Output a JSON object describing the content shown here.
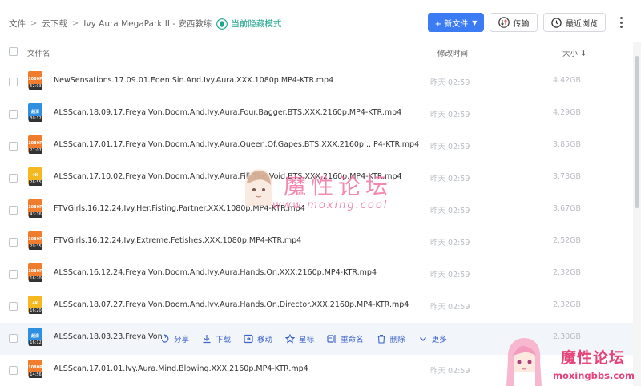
{
  "breadcrumb": {
    "items": [
      "文件",
      "云下载",
      "Ivy Aura MegaPark II - 安西教练"
    ],
    "separator": ">",
    "mode_label": "当前隐藏模式"
  },
  "toolbar": {
    "new_label": "+ 新文件",
    "transfer_label": "传输",
    "recent_label": "最近浏览"
  },
  "table": {
    "headers": {
      "name": "文件名",
      "time": "修改时间",
      "size": "大小 ⬇"
    }
  },
  "files": [
    {
      "name": "NewSensations.17.09.01.Eden.Sin.And.Ivy.Aura.XXX.1080p.MP4-KTR.mp4",
      "time": "昨天 02:59",
      "size": "4.42GB",
      "badge": "1080P",
      "duration": "52:03",
      "color": "#f07c2e"
    },
    {
      "name": "ALSScan.18.09.17.Freya.Von.Doom.And.Ivy.Aura.Four.Bagger.BTS.XXX.2160p.MP4-KTR.mp4",
      "time": "昨天 02:59",
      "size": "4.29GB",
      "badge": "超清",
      "duration": "30:12",
      "color": "#2f8fe0"
    },
    {
      "name": "ALSScan.17.01.17.Freya.Von.Doom.And.Ivy.Aura.Queen.Of.Gapes.BTS.XXX.2160p... P4-KTR.mp4",
      "time": "昨天 02:59",
      "size": "3.85GB",
      "badge": "1080P",
      "duration": "27:07",
      "color": "#f07c2e"
    },
    {
      "name": "ALSScan.17.10.02.Freya.Von.Doom.And.Ivy.Aura.Fill.The.Void.BTS.XXX.2160p.MP4-KTR.mp4",
      "time": "昨天 02:59",
      "size": "3.73GB",
      "badge": "4K",
      "duration": "26:55",
      "color": "#f5b820"
    },
    {
      "name": "FTVGirls.16.12.24.Ivy.Her.Fisting.Partner.XXX.1080p.MP4-KTR.mp4",
      "time": "昨天 02:59",
      "size": "3.67GB",
      "badge": "1080P",
      "duration": "43:16",
      "color": "#f07c2e"
    },
    {
      "name": "FTVGirls.16.12.24.Ivy.Extreme.Fetishes.XXX.1080p.MP4-KTR.mp4",
      "time": "昨天 02:59",
      "size": "2.52GB",
      "badge": "1080P",
      "duration": "29:35",
      "color": "#f07c2e"
    },
    {
      "name": "ALSScan.16.12.24.Freya.Von.Doom.And.Ivy.Aura.Hands.On.XXX.2160p.MP4-KTR.mp4",
      "time": "昨天 02:59",
      "size": "2.32GB",
      "badge": "1080P",
      "duration": "16:20",
      "color": "#f07c2e"
    },
    {
      "name": "ALSScan.18.07.27.Freya.Von.Doom.And.Ivy.Aura.Hands.On.Director.XXX.2160p.MP4-KTR.mp4",
      "time": "昨天 02:59",
      "size": "2.32GB",
      "badge": "4K",
      "duration": "16:20",
      "color": "#f5b820"
    },
    {
      "name": "ALSScan.18.03.23.Freya.Von",
      "time": "",
      "size": "2.30GB",
      "badge": "超清",
      "duration": "16:12",
      "color": "#2f8fe0"
    },
    {
      "name": "ALSScan.17.01.01.Ivy.Aura.Mind.Blowing.XXX.2160p.MP4-KTR.mp4",
      "time": "昨天 02:59",
      "size": "",
      "badge": "1080P",
      "duration": "14:56",
      "color": "#f07c2e"
    }
  ],
  "row_actions": {
    "share": "分享",
    "download": "下载",
    "move": "移动",
    "star": "星标",
    "rename": "重命名",
    "delete": "删除",
    "more": "更多"
  },
  "watermark": {
    "center_title": "魔性论坛",
    "center_url": "www.moxing.cool",
    "corner_title": "魔性论坛",
    "corner_url": "moxingbbs.com"
  }
}
